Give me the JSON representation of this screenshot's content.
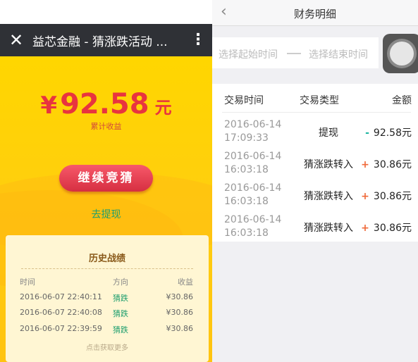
{
  "left": {
    "app_title": "益芯金融 - 猜涨跌活动 ...",
    "close_icon": "close-icon",
    "more_icon": "more-vertical-icon",
    "amount": {
      "currency": "¥",
      "value": "92.58",
      "unit": "元",
      "caption": "累计收益"
    },
    "continue_button": "继续竞猜",
    "withdraw_link": "去提现",
    "history": {
      "title": "历史战绩",
      "headers": [
        "时间",
        "方向",
        "收益"
      ],
      "rows": [
        {
          "time": "2016-06-07 22:40:11",
          "direction": "猜跌",
          "profit": "¥30.86"
        },
        {
          "time": "2016-06-07 22:40:08",
          "direction": "猜跌",
          "profit": "¥30.86"
        },
        {
          "time": "2016-06-07 22:39:59",
          "direction": "猜跌",
          "profit": "¥30.86"
        }
      ],
      "more": "点击获取更多"
    },
    "colors": {
      "hero": "#ffd600",
      "amount": "#e8343f",
      "button": "#e04052",
      "green": "#1e9e6e",
      "card": "#fff6d3"
    }
  },
  "right": {
    "title": "财务明细",
    "back_icon": "chevron-left-icon",
    "start_placeholder": "选择起始时间",
    "separator": "——",
    "end_placeholder": "选择结束时间",
    "assistive_icon": "assistive-touch-icon",
    "headers": {
      "time": "交易时间",
      "type": "交易类型",
      "amount": "金额"
    },
    "rows": [
      {
        "date": "2016-06-14",
        "time": "17:09:33",
        "type": "提现",
        "sign": "-",
        "amount": "92.58元",
        "sign_color": "#1db5a0"
      },
      {
        "date": "2016-06-14",
        "time": "16:03:18",
        "type": "猜涨跌转入",
        "sign": "+",
        "amount": "30.86元",
        "sign_color": "#f06a3a"
      },
      {
        "date": "2016-06-14",
        "time": "16:03:18",
        "type": "猜涨跌转入",
        "sign": "+",
        "amount": "30.86元",
        "sign_color": "#f06a3a"
      },
      {
        "date": "2016-06-14",
        "time": "16:03:18",
        "type": "猜涨跌转入",
        "sign": "+",
        "amount": "30.86元",
        "sign_color": "#f06a3a"
      }
    ]
  }
}
